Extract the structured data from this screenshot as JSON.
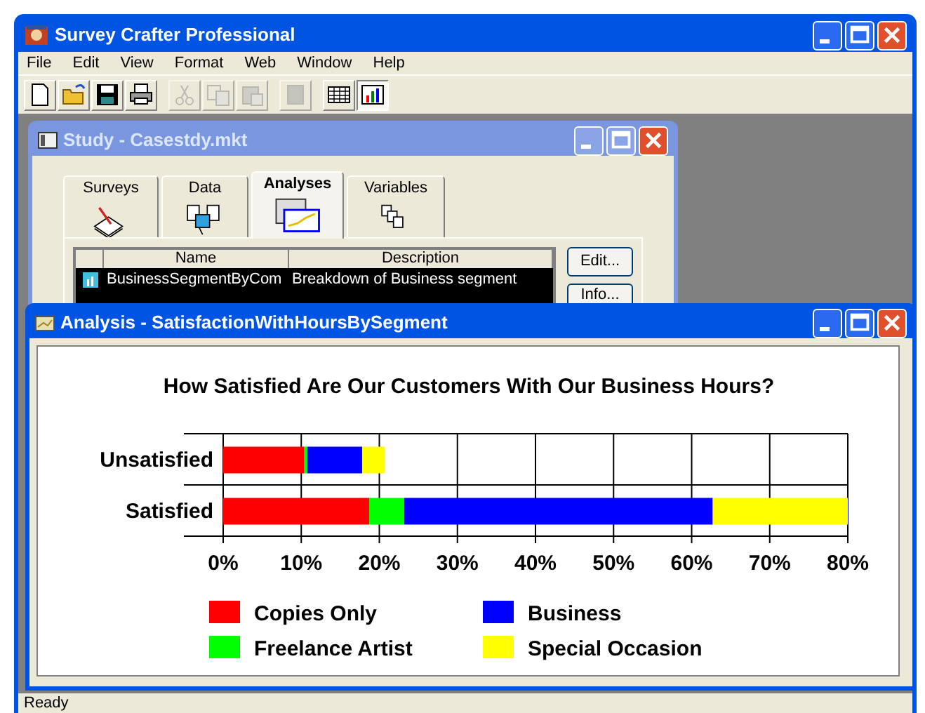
{
  "app": {
    "title": "Survey Crafter Professional"
  },
  "menu": [
    "File",
    "Edit",
    "View",
    "Format",
    "Web",
    "Window",
    "Help"
  ],
  "toolbar": [
    {
      "kind": "new",
      "disabled": false
    },
    {
      "kind": "open",
      "disabled": false
    },
    {
      "kind": "save",
      "disabled": false
    },
    {
      "kind": "print",
      "disabled": false
    },
    {
      "kind": "cut",
      "disabled": true
    },
    {
      "kind": "copy",
      "disabled": true
    },
    {
      "kind": "paste",
      "disabled": true
    },
    {
      "kind": "stop",
      "disabled": true
    },
    {
      "kind": "table",
      "disabled": false,
      "selected": false
    },
    {
      "kind": "chart",
      "disabled": false,
      "selected": true
    }
  ],
  "study_window": {
    "title": "Study - Casestdy.mkt",
    "tabs": [
      {
        "label": "Surveys",
        "kind": "surveys",
        "selected": false
      },
      {
        "label": "Data",
        "kind": "data",
        "selected": false
      },
      {
        "label": "Analyses",
        "kind": "analyses",
        "selected": true
      },
      {
        "label": "Variables",
        "kind": "variables",
        "selected": false
      }
    ],
    "table": {
      "columns": [
        "Name",
        "Description"
      ],
      "rows": [
        {
          "name": "BusinessSegmentByCom",
          "description": "Breakdown of Business segment",
          "selected": true
        }
      ]
    },
    "buttons": [
      "Edit...",
      "Info..."
    ]
  },
  "analysis_window": {
    "title": "Analysis - SatisfactionWithHoursBySegment",
    "chart_data": {
      "type": "bar",
      "orientation": "horizontal",
      "stacked": true,
      "title": "How Satisfied Are Our Customers With Our Business Hours?",
      "categories": [
        "Unsatisfied",
        "Satisfied"
      ],
      "series": [
        {
          "name": "Copies Only",
          "color": "#ff0000",
          "values": [
            10.4,
            18.7
          ]
        },
        {
          "name": "Freelance Artist",
          "color": "#00ff00",
          "values": [
            0.4,
            4.5
          ]
        },
        {
          "name": "Business",
          "color": "#0000ff",
          "values": [
            7.0,
            39.5
          ]
        },
        {
          "name": "Special Occasion",
          "color": "#ffff00",
          "values": [
            2.9,
            17.3
          ]
        }
      ],
      "grid": true,
      "legend": true,
      "xlim": [
        0,
        80
      ],
      "xticks": [
        {
          "value": 0,
          "label": "0%"
        },
        {
          "value": 10,
          "label": "10%"
        },
        {
          "value": 20,
          "label": "20%"
        },
        {
          "value": 30,
          "label": "30%"
        },
        {
          "value": 40,
          "label": "40%"
        },
        {
          "value": 50,
          "label": "50%"
        },
        {
          "value": 60,
          "label": "60%"
        },
        {
          "value": 70,
          "label": "70%"
        },
        {
          "value": 80,
          "label": "80%"
        }
      ]
    }
  },
  "status_bar": {
    "text": "Ready"
  }
}
